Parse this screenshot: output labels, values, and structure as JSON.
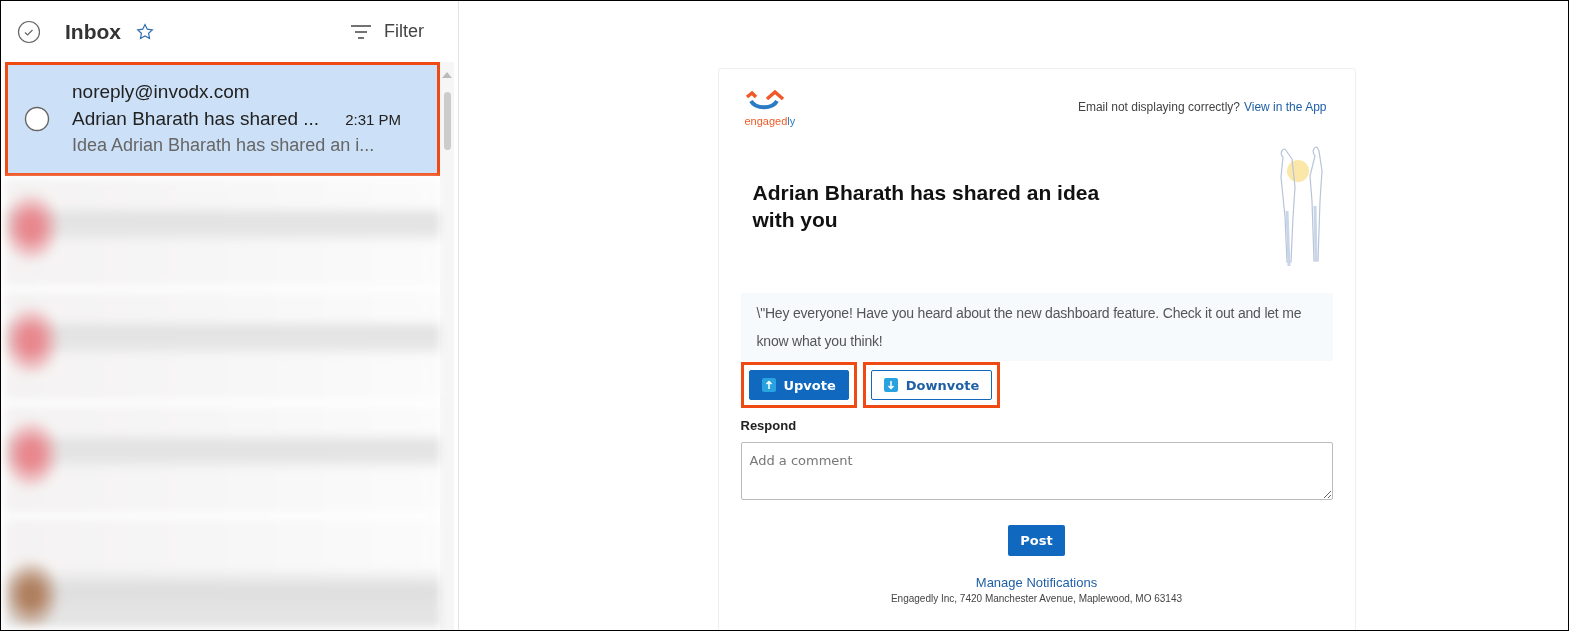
{
  "mail_list": {
    "title": "Inbox",
    "filter_label": "Filter",
    "messages": [
      {
        "sender": "noreply@invodx.com",
        "subject": "Adrian Bharath has shared ...",
        "time": "2:31 PM",
        "preview": "Idea Adrian Bharath has shared an i...",
        "selected": true,
        "highlighted": true
      }
    ]
  },
  "email": {
    "logo": {
      "main": "engaged",
      "accent": "ly"
    },
    "top_note": "Email not displaying correctly?",
    "top_link": "View in the App",
    "heading": "Adrian Bharath has shared an idea with you",
    "quote": "\\\"Hey everyone! Have you heard about the new dashboard feature. Check it out and let me know what you think!",
    "votes": [
      {
        "kind": "up",
        "label": "Upvote",
        "highlighted": true
      },
      {
        "kind": "down",
        "label": "Downvote",
        "highlighted": true
      }
    ],
    "respond_label": "Respond",
    "comment_placeholder": "Add a comment",
    "post_label": "Post",
    "manage_link": "Manage Notifications",
    "address": "Engagedly Inc, 7420 Manchester Avenue, Maplewood, MO 63143"
  }
}
